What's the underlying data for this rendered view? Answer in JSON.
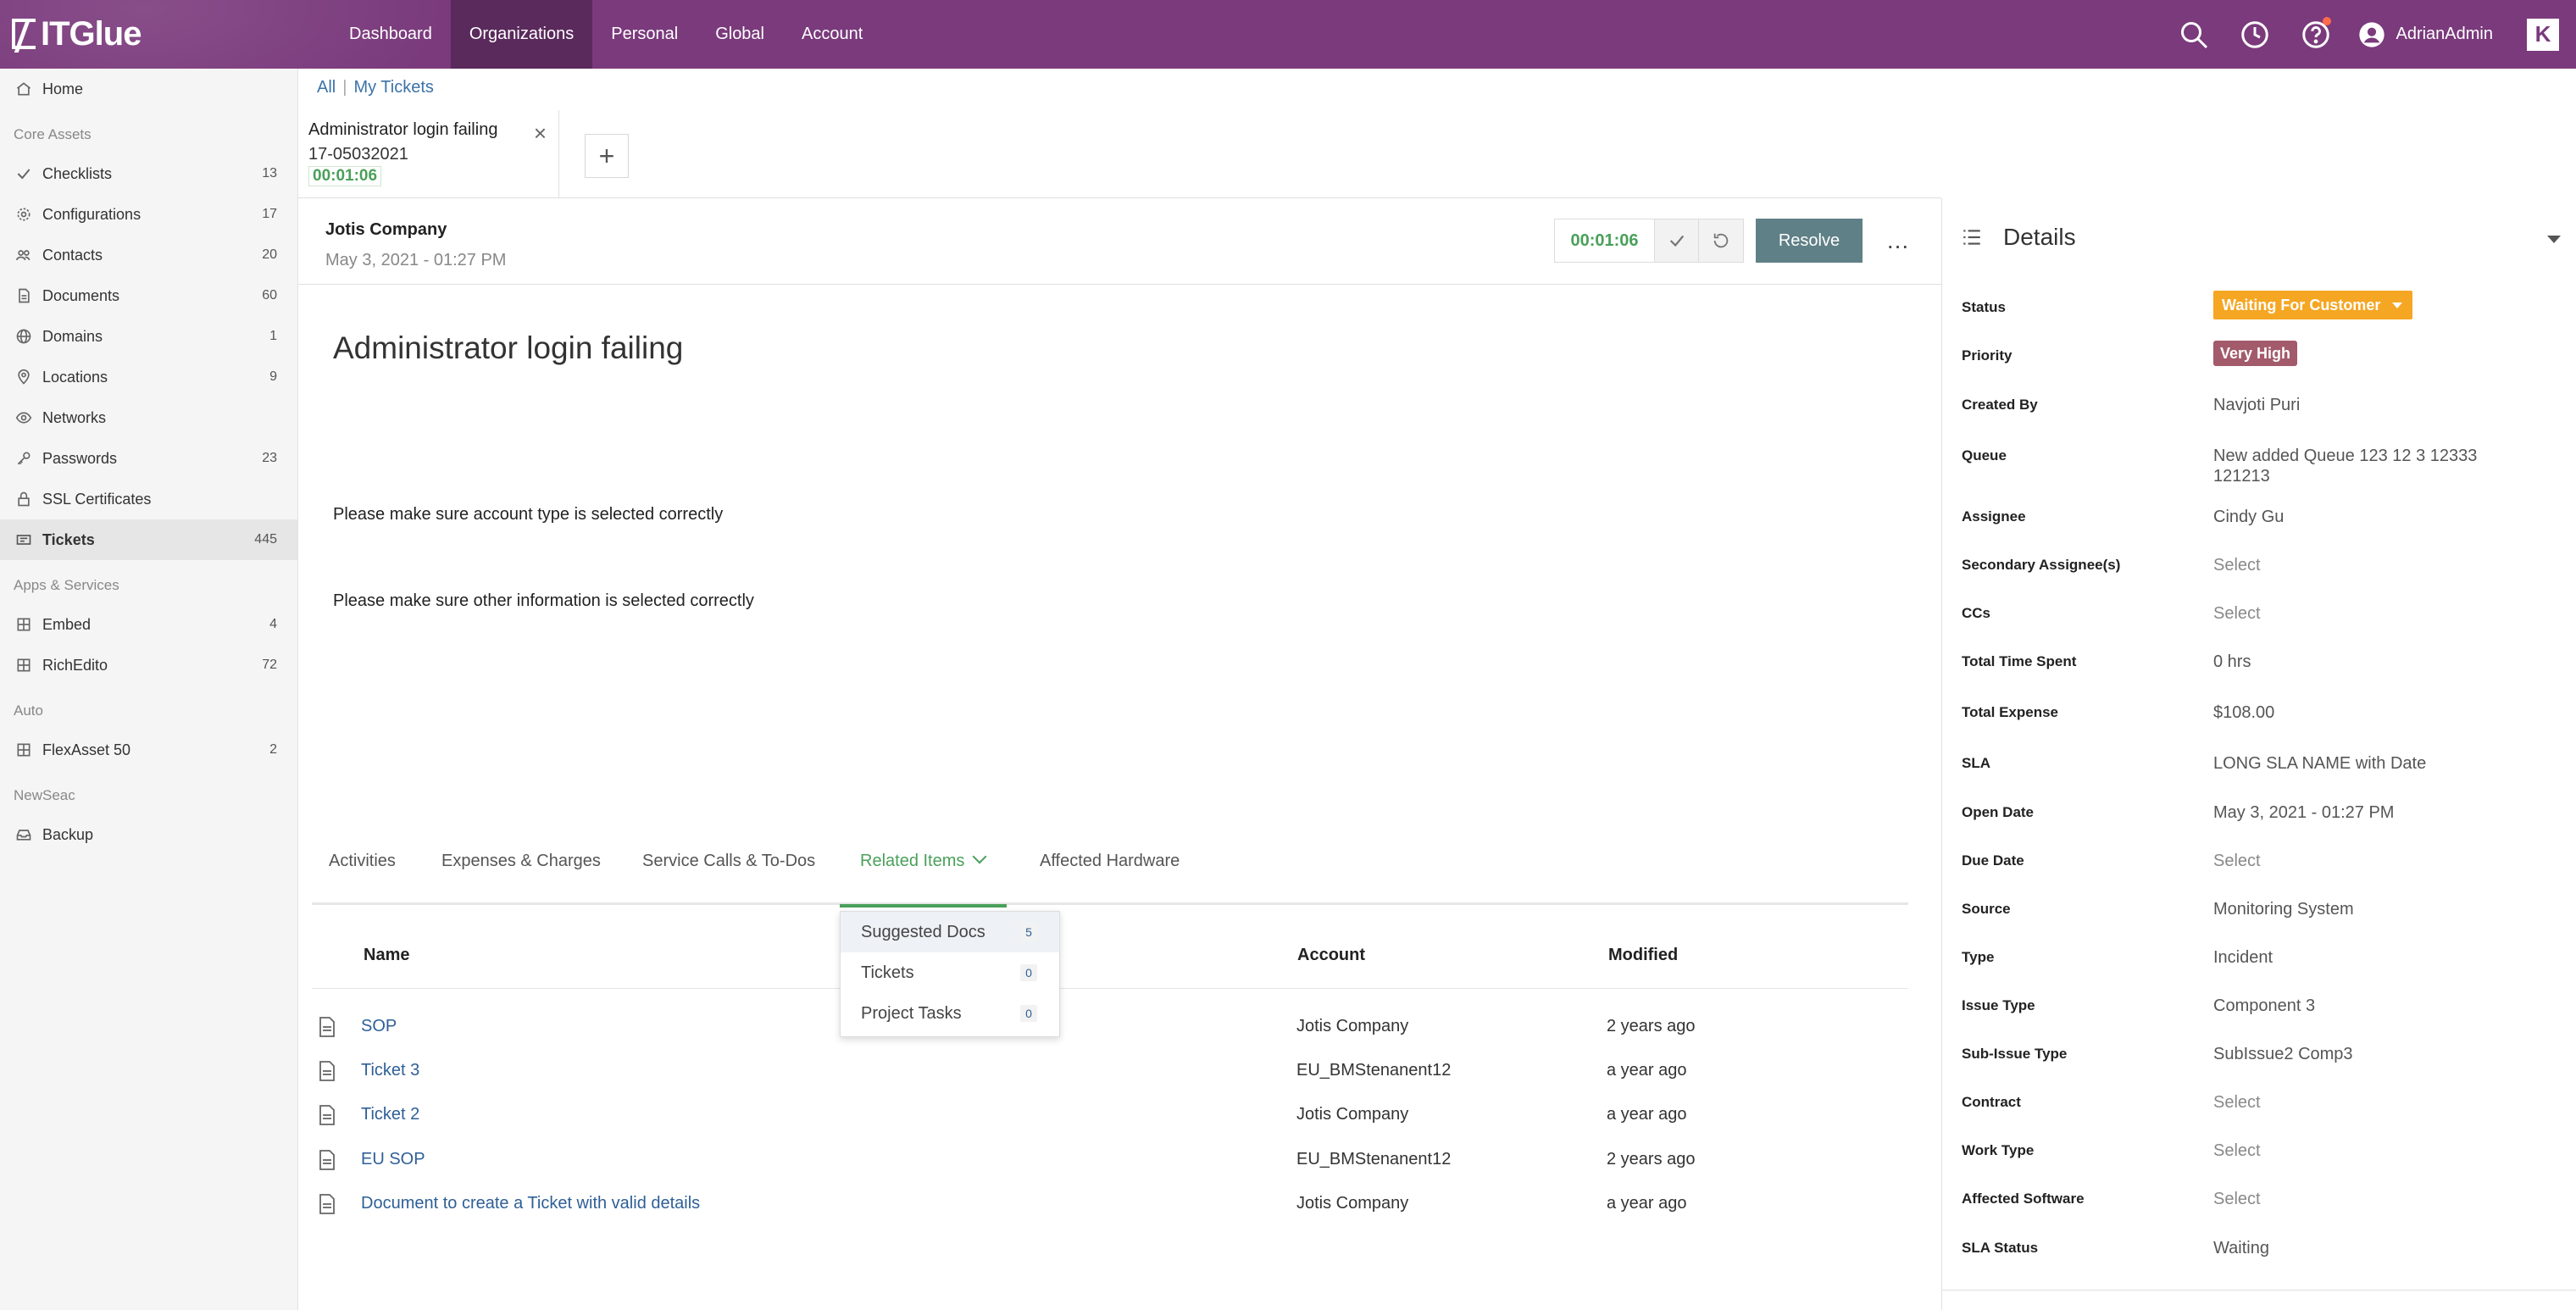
{
  "app": {
    "logo_text": "ITGlue",
    "brand_badge": "K"
  },
  "topnav": {
    "links": [
      "Dashboard",
      "Organizations",
      "Personal",
      "Global",
      "Account"
    ],
    "user": "AdrianAdmin"
  },
  "sidebar": {
    "home": "Home",
    "sections": {
      "core": "Core Assets",
      "apps": "Apps & Services",
      "auto": "Auto",
      "newseac": "NewSeac"
    },
    "core_items": [
      {
        "label": "Checklists",
        "count": "13",
        "icon": "check-icon"
      },
      {
        "label": "Configurations",
        "count": "17",
        "icon": "gear-icon"
      },
      {
        "label": "Contacts",
        "count": "20",
        "icon": "people-icon"
      },
      {
        "label": "Documents",
        "count": "60",
        "icon": "document-icon"
      },
      {
        "label": "Domains",
        "count": "1",
        "icon": "globe-icon"
      },
      {
        "label": "Locations",
        "count": "9",
        "icon": "location-pin-icon"
      },
      {
        "label": "Networks",
        "count": "",
        "icon": "network-icon"
      },
      {
        "label": "Passwords",
        "count": "23",
        "icon": "key-icon"
      },
      {
        "label": "SSL Certificates",
        "count": "",
        "icon": "lock-icon"
      },
      {
        "label": "Tickets",
        "count": "445",
        "icon": "ticket-icon"
      }
    ],
    "apps_items": [
      {
        "label": "Embed",
        "count": "4",
        "icon": "grid-icon"
      },
      {
        "label": "RichEdito",
        "count": "72",
        "icon": "grid-icon"
      }
    ],
    "auto_items": [
      {
        "label": "FlexAsset 50",
        "count": "2",
        "icon": "grid-icon"
      }
    ],
    "newseac_items": [
      {
        "label": "Backup",
        "count": "",
        "icon": "inbox-icon"
      }
    ]
  },
  "breadcrumb": {
    "all": "All",
    "current": "My Tickets"
  },
  "ticket_tab": {
    "title": "Administrator login failing",
    "id": "17-05032021",
    "timer": "00:01:06"
  },
  "header": {
    "company": "Jotis Company",
    "date": "May 3, 2021 - 01:27 PM",
    "timer": "00:01:06",
    "resolve_label": "Resolve",
    "more_label": "..."
  },
  "body": {
    "title": "Administrator login failing",
    "lines": [
      "Please make sure account type is selected correctly",
      "Please make sure other information is selected correctly"
    ]
  },
  "tabs": {
    "items": [
      "Activities",
      "Expenses & Charges",
      "Service Calls & To-Dos",
      "Related Items",
      "Affected Hardware"
    ],
    "active": "Related Items"
  },
  "related_dropdown": [
    {
      "label": "Suggested Docs",
      "count": "5"
    },
    {
      "label": "Tickets",
      "count": "0"
    },
    {
      "label": "Project Tasks",
      "count": "0"
    }
  ],
  "table": {
    "columns": {
      "name": "Name",
      "account": "Account",
      "modified": "Modified"
    },
    "rows": [
      {
        "name": "SOP",
        "account": "Jotis Company",
        "modified": "2 years ago"
      },
      {
        "name": "Ticket 3",
        "account": "EU_BMStenanent12",
        "modified": "a year ago"
      },
      {
        "name": "Ticket 2",
        "account": "Jotis Company",
        "modified": "a year ago"
      },
      {
        "name": "EU SOP",
        "account": "EU_BMStenanent12",
        "modified": "2 years ago"
      },
      {
        "name": "Document to create a Ticket with valid details",
        "account": "Jotis Company",
        "modified": "a year ago"
      }
    ]
  },
  "details": {
    "title": "Details",
    "status": {
      "label": "Status",
      "value": "Waiting For Customer",
      "color": "#f5a623"
    },
    "priority": {
      "label": "Priority",
      "value": "Very High",
      "color": "#a35a6a"
    },
    "fields": [
      {
        "label": "Created By",
        "value": "Navjoti Puri",
        "placeholder": false
      },
      {
        "label": "Queue",
        "value": "New added Queue 123 12 3 12333 121213",
        "placeholder": false
      },
      {
        "label": "Assignee",
        "value": "Cindy Gu",
        "placeholder": false
      },
      {
        "label": "Secondary Assignee(s)",
        "value": "Select",
        "placeholder": true
      },
      {
        "label": "CCs",
        "value": "Select",
        "placeholder": true
      },
      {
        "label": "Total Time Spent",
        "value": "0 hrs",
        "placeholder": false
      },
      {
        "label": "Total Expense",
        "value": "$108.00",
        "placeholder": false
      },
      {
        "label": "SLA",
        "value": "LONG SLA NAME with Date",
        "placeholder": false
      },
      {
        "label": "Open Date",
        "value": "May 3, 2021 - 01:27 PM",
        "placeholder": false
      },
      {
        "label": "Due Date",
        "value": "Select",
        "placeholder": true
      },
      {
        "label": "Source",
        "value": "Monitoring System",
        "placeholder": false
      },
      {
        "label": "Type",
        "value": "Incident",
        "placeholder": false
      },
      {
        "label": "Issue Type",
        "value": "Component 3",
        "placeholder": false
      },
      {
        "label": "Sub-Issue Type",
        "value": "SubIssue2 Comp3",
        "placeholder": false
      },
      {
        "label": "Contract",
        "value": "Select",
        "placeholder": true
      },
      {
        "label": "Work Type",
        "value": "Select",
        "placeholder": true
      },
      {
        "label": "Affected Software",
        "value": "Select",
        "placeholder": true
      },
      {
        "label": "SLA Status",
        "value": "Waiting",
        "placeholder": false
      }
    ]
  }
}
